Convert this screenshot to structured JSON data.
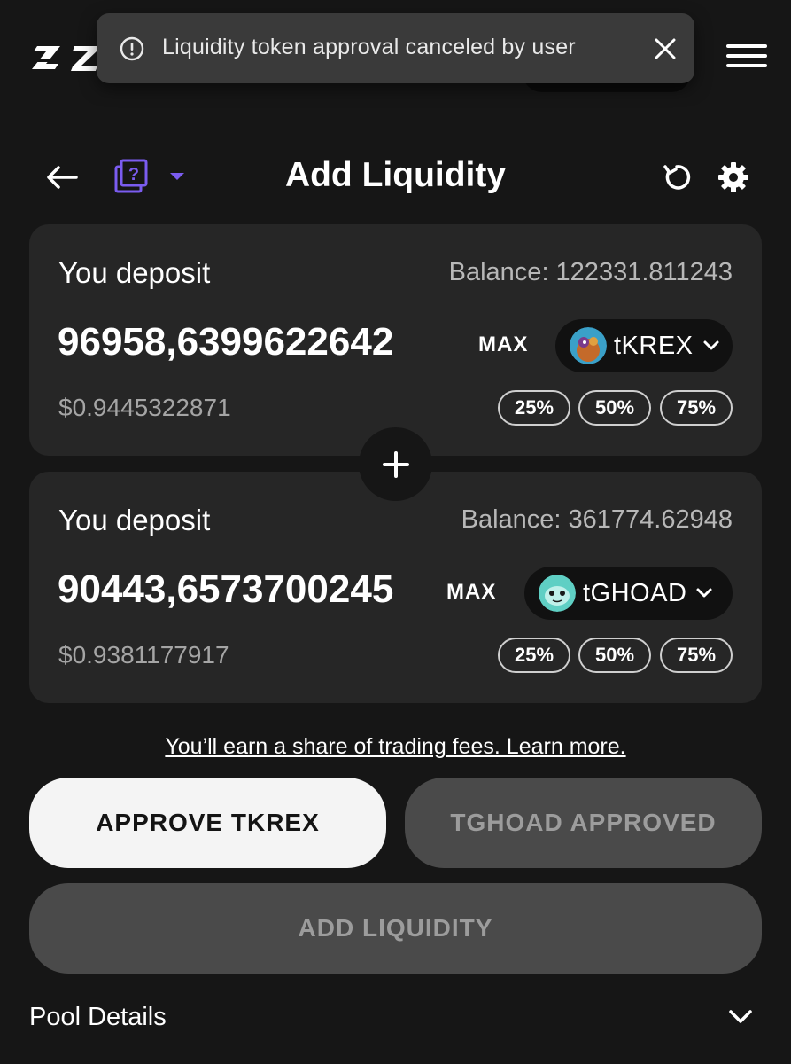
{
  "toast": {
    "message": "Liquidity token approval canceled by user",
    "icon": "info-circle-icon",
    "close_icon": "close-icon"
  },
  "header": {
    "title": "Add Liquidity"
  },
  "deposits": [
    {
      "label": "You deposit",
      "balance": "Balance: 122331.811243",
      "amount": "96958,6399622642",
      "max_label": "MAX",
      "token": "tKREX",
      "usd_value": "$0.9445322871",
      "percents": [
        "25%",
        "50%",
        "75%"
      ]
    },
    {
      "label": "You deposit",
      "balance": "Balance: 361774.62948",
      "amount": "90443,6573700245",
      "max_label": "MAX",
      "token": "tGHOAD",
      "usd_value": "$0.9381177917",
      "percents": [
        "25%",
        "50%",
        "75%"
      ]
    }
  ],
  "earn_link": "You’ll earn a share of trading fees. Learn more.",
  "buttons": {
    "approve": "APPROVE TKREX",
    "approved": "TGHOAD APPROVED",
    "add": "ADD LIQUIDITY"
  },
  "pool_details": "Pool Details",
  "colors": {
    "background": "#161616",
    "card": "#262626",
    "accent_purple": "#7b5cf0",
    "primary_button": "#f4f4f4",
    "disabled_button": "#4a4a4a"
  }
}
